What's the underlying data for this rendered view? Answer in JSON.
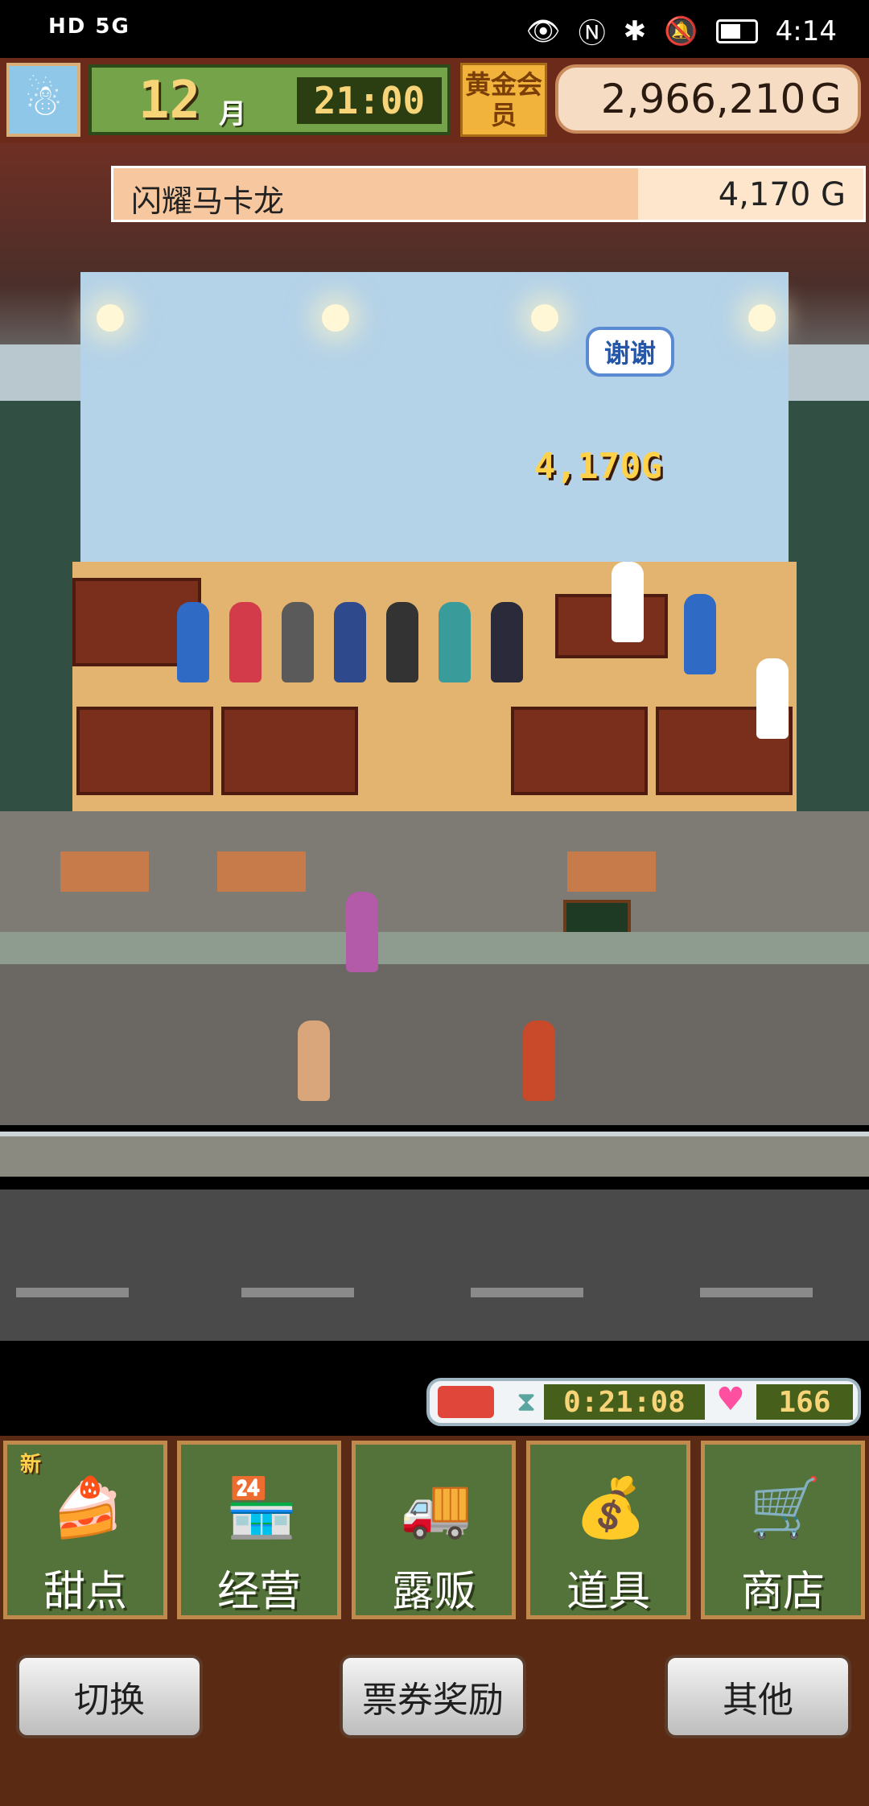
{
  "status_bar": {
    "indicators": "HD 5G",
    "time": "4:14"
  },
  "hud": {
    "month": "12",
    "month_unit": "月",
    "time": "21:00",
    "membership": "黄金会员",
    "money": "2,966,210",
    "money_unit": "G"
  },
  "sale": {
    "item": "闪耀马卡龙",
    "price": "4,170 G",
    "progress": 0.7
  },
  "scene": {
    "speech": "谢谢",
    "popup_price": "4,170G"
  },
  "stats": {
    "timer": "0:21:08",
    "hearts": "166"
  },
  "menu": {
    "new_badge": "新",
    "items": [
      {
        "label": "甜点",
        "icon": "cake-icon"
      },
      {
        "label": "经营",
        "icon": "shop-icon"
      },
      {
        "label": "露贩",
        "icon": "food-truck-icon"
      },
      {
        "label": "道具",
        "icon": "items-bag-icon"
      },
      {
        "label": "商店",
        "icon": "shopping-cart-icon"
      }
    ]
  },
  "bottom": {
    "switch": "切换",
    "ticket_reward": "票券奖励",
    "other": "其他"
  },
  "colors": {
    "gold_text": "#f8d478",
    "menu_green": "#53733b",
    "frame_brown": "#5b2a14"
  }
}
